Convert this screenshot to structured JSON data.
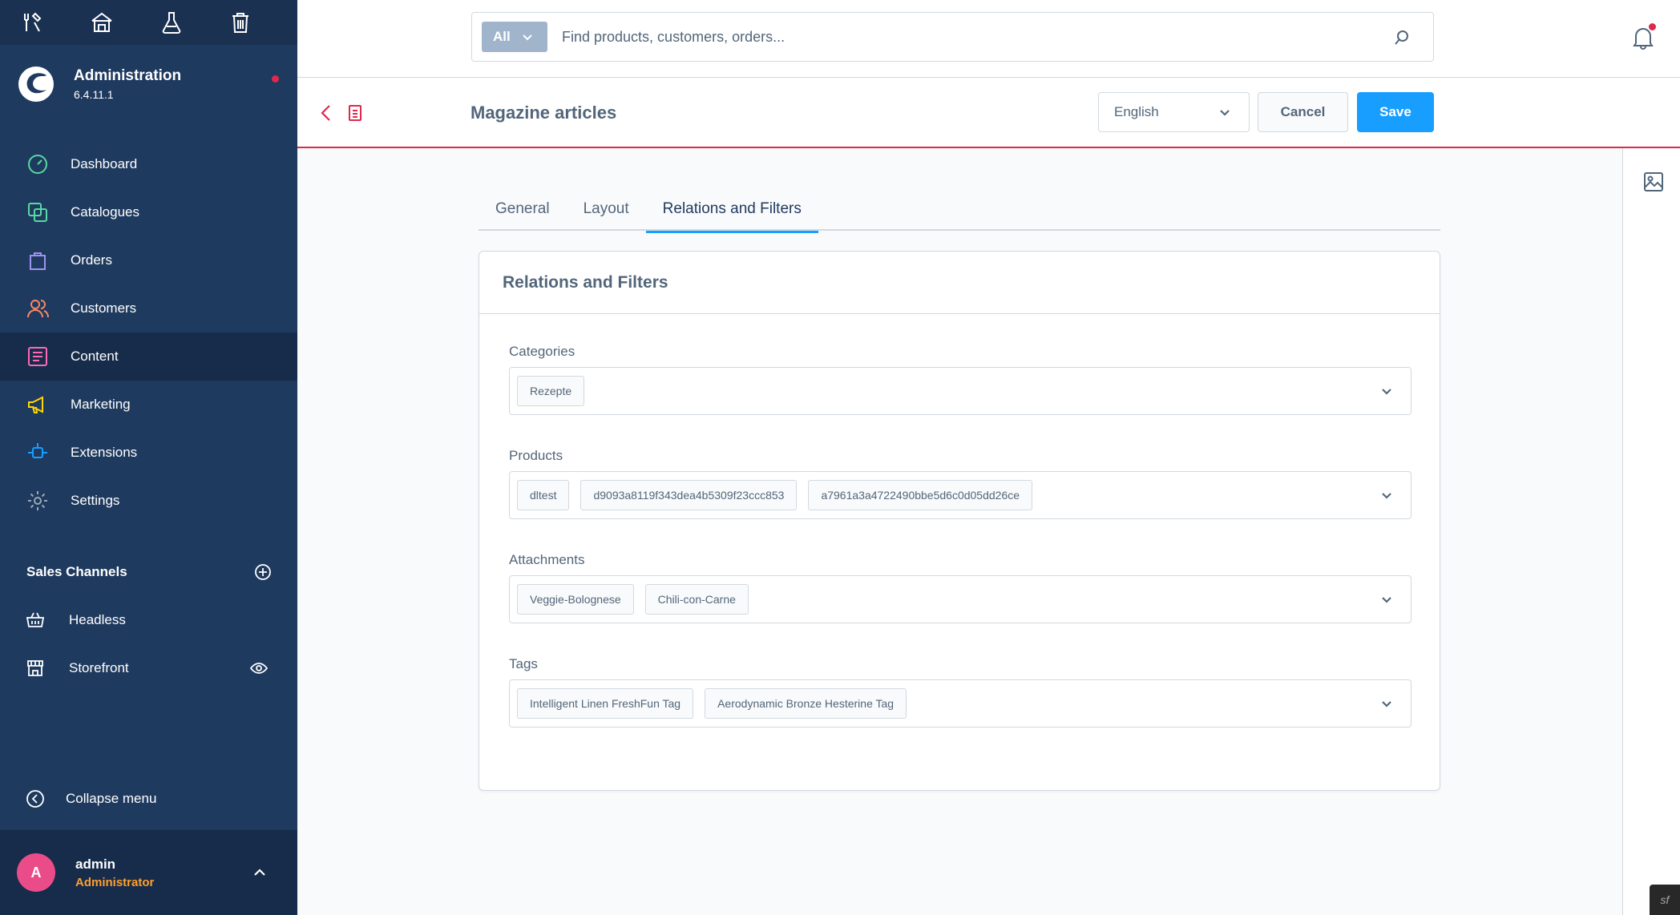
{
  "sidebar": {
    "brand_title": "Administration",
    "brand_version": "6.4.11.1",
    "nav": [
      {
        "label": "Dashboard",
        "icon": "dashboard-icon",
        "color": "#57d9a3"
      },
      {
        "label": "Catalogues",
        "icon": "catalogue-icon",
        "color": "#57d9a3"
      },
      {
        "label": "Orders",
        "icon": "orders-icon",
        "color": "#a092f0"
      },
      {
        "label": "Customers",
        "icon": "customers-icon",
        "color": "#f88962"
      },
      {
        "label": "Content",
        "icon": "content-icon",
        "color": "#ff68b4"
      },
      {
        "label": "Marketing",
        "icon": "marketing-icon",
        "color": "#ffd700"
      },
      {
        "label": "Extensions",
        "icon": "extensions-icon",
        "color": "#189eff"
      },
      {
        "label": "Settings",
        "icon": "settings-icon",
        "color": "#9aa8b5"
      }
    ],
    "sales_channels_title": "Sales Channels",
    "sales_channels": [
      {
        "label": "Headless",
        "icon": "basket-icon"
      },
      {
        "label": "Storefront",
        "icon": "storefront-icon"
      }
    ],
    "collapse_label": "Collapse menu",
    "user": {
      "initial": "A",
      "name": "admin",
      "role": "Administrator"
    }
  },
  "search": {
    "scope": "All",
    "placeholder": "Find products, customers, orders..."
  },
  "smartbar": {
    "title": "Magazine articles",
    "language": "English",
    "cancel_label": "Cancel",
    "save_label": "Save"
  },
  "tabs": [
    {
      "label": "General",
      "active": false
    },
    {
      "label": "Layout",
      "active": false
    },
    {
      "label": "Relations and Filters",
      "active": true
    }
  ],
  "card": {
    "title": "Relations and Filters",
    "fields": [
      {
        "label": "Categories",
        "chips": [
          "Rezepte"
        ]
      },
      {
        "label": "Products",
        "chips": [
          "dltest",
          "d9093a8119f343dea4b5309f23ccc853",
          "a7961a3a4722490bbe5d6c0d05dd26ce"
        ]
      },
      {
        "label": "Attachments",
        "chips": [
          "Veggie-Bolognese",
          "Chili-con-Carne"
        ]
      },
      {
        "label": "Tags",
        "chips": [
          "Intelligent Linen FreshFun Tag",
          "Aerodynamic Bronze Hesterine Tag"
        ]
      }
    ]
  },
  "colors": {
    "sidebar_bg": "#1f3a5f",
    "primary": "#189eff",
    "accent_red": "#de294c"
  }
}
